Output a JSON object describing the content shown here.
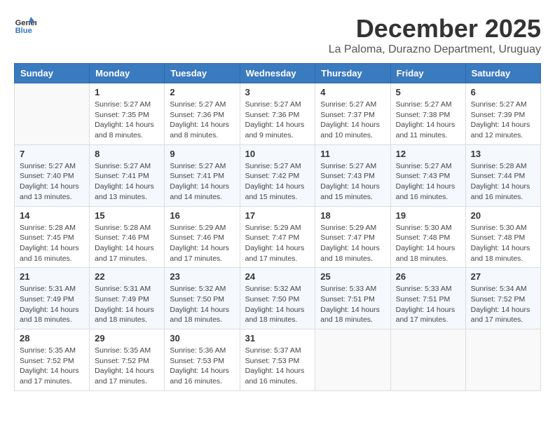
{
  "logo": {
    "general": "General",
    "blue": "Blue"
  },
  "title": "December 2025",
  "location": "La Paloma, Durazno Department, Uruguay",
  "days_of_week": [
    "Sunday",
    "Monday",
    "Tuesday",
    "Wednesday",
    "Thursday",
    "Friday",
    "Saturday"
  ],
  "weeks": [
    [
      {
        "day": "",
        "info": ""
      },
      {
        "day": "1",
        "info": "Sunrise: 5:27 AM\nSunset: 7:35 PM\nDaylight: 14 hours\nand 8 minutes."
      },
      {
        "day": "2",
        "info": "Sunrise: 5:27 AM\nSunset: 7:36 PM\nDaylight: 14 hours\nand 8 minutes."
      },
      {
        "day": "3",
        "info": "Sunrise: 5:27 AM\nSunset: 7:36 PM\nDaylight: 14 hours\nand 9 minutes."
      },
      {
        "day": "4",
        "info": "Sunrise: 5:27 AM\nSunset: 7:37 PM\nDaylight: 14 hours\nand 10 minutes."
      },
      {
        "day": "5",
        "info": "Sunrise: 5:27 AM\nSunset: 7:38 PM\nDaylight: 14 hours\nand 11 minutes."
      },
      {
        "day": "6",
        "info": "Sunrise: 5:27 AM\nSunset: 7:39 PM\nDaylight: 14 hours\nand 12 minutes."
      }
    ],
    [
      {
        "day": "7",
        "info": "Sunrise: 5:27 AM\nSunset: 7:40 PM\nDaylight: 14 hours\nand 13 minutes."
      },
      {
        "day": "8",
        "info": "Sunrise: 5:27 AM\nSunset: 7:41 PM\nDaylight: 14 hours\nand 13 minutes."
      },
      {
        "day": "9",
        "info": "Sunrise: 5:27 AM\nSunset: 7:41 PM\nDaylight: 14 hours\nand 14 minutes."
      },
      {
        "day": "10",
        "info": "Sunrise: 5:27 AM\nSunset: 7:42 PM\nDaylight: 14 hours\nand 15 minutes."
      },
      {
        "day": "11",
        "info": "Sunrise: 5:27 AM\nSunset: 7:43 PM\nDaylight: 14 hours\nand 15 minutes."
      },
      {
        "day": "12",
        "info": "Sunrise: 5:27 AM\nSunset: 7:43 PM\nDaylight: 14 hours\nand 16 minutes."
      },
      {
        "day": "13",
        "info": "Sunrise: 5:28 AM\nSunset: 7:44 PM\nDaylight: 14 hours\nand 16 minutes."
      }
    ],
    [
      {
        "day": "14",
        "info": "Sunrise: 5:28 AM\nSunset: 7:45 PM\nDaylight: 14 hours\nand 16 minutes."
      },
      {
        "day": "15",
        "info": "Sunrise: 5:28 AM\nSunset: 7:46 PM\nDaylight: 14 hours\nand 17 minutes."
      },
      {
        "day": "16",
        "info": "Sunrise: 5:29 AM\nSunset: 7:46 PM\nDaylight: 14 hours\nand 17 minutes."
      },
      {
        "day": "17",
        "info": "Sunrise: 5:29 AM\nSunset: 7:47 PM\nDaylight: 14 hours\nand 17 minutes."
      },
      {
        "day": "18",
        "info": "Sunrise: 5:29 AM\nSunset: 7:47 PM\nDaylight: 14 hours\nand 18 minutes."
      },
      {
        "day": "19",
        "info": "Sunrise: 5:30 AM\nSunset: 7:48 PM\nDaylight: 14 hours\nand 18 minutes."
      },
      {
        "day": "20",
        "info": "Sunrise: 5:30 AM\nSunset: 7:48 PM\nDaylight: 14 hours\nand 18 minutes."
      }
    ],
    [
      {
        "day": "21",
        "info": "Sunrise: 5:31 AM\nSunset: 7:49 PM\nDaylight: 14 hours\nand 18 minutes."
      },
      {
        "day": "22",
        "info": "Sunrise: 5:31 AM\nSunset: 7:49 PM\nDaylight: 14 hours\nand 18 minutes."
      },
      {
        "day": "23",
        "info": "Sunrise: 5:32 AM\nSunset: 7:50 PM\nDaylight: 14 hours\nand 18 minutes."
      },
      {
        "day": "24",
        "info": "Sunrise: 5:32 AM\nSunset: 7:50 PM\nDaylight: 14 hours\nand 18 minutes."
      },
      {
        "day": "25",
        "info": "Sunrise: 5:33 AM\nSunset: 7:51 PM\nDaylight: 14 hours\nand 18 minutes."
      },
      {
        "day": "26",
        "info": "Sunrise: 5:33 AM\nSunset: 7:51 PM\nDaylight: 14 hours\nand 17 minutes."
      },
      {
        "day": "27",
        "info": "Sunrise: 5:34 AM\nSunset: 7:52 PM\nDaylight: 14 hours\nand 17 minutes."
      }
    ],
    [
      {
        "day": "28",
        "info": "Sunrise: 5:35 AM\nSunset: 7:52 PM\nDaylight: 14 hours\nand 17 minutes."
      },
      {
        "day": "29",
        "info": "Sunrise: 5:35 AM\nSunset: 7:52 PM\nDaylight: 14 hours\nand 17 minutes."
      },
      {
        "day": "30",
        "info": "Sunrise: 5:36 AM\nSunset: 7:53 PM\nDaylight: 14 hours\nand 16 minutes."
      },
      {
        "day": "31",
        "info": "Sunrise: 5:37 AM\nSunset: 7:53 PM\nDaylight: 14 hours\nand 16 minutes."
      },
      {
        "day": "",
        "info": ""
      },
      {
        "day": "",
        "info": ""
      },
      {
        "day": "",
        "info": ""
      }
    ]
  ]
}
